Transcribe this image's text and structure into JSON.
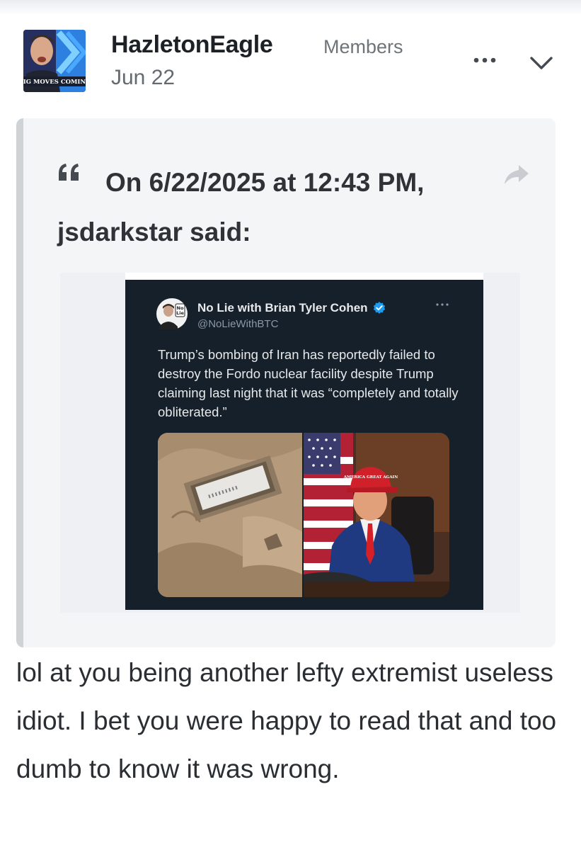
{
  "post": {
    "author": "HazletonEagle",
    "group": "Members",
    "date": "Jun 22",
    "avatar_caption": "BIG MOVES COMING",
    "quote": {
      "citation": "On 6/22/2025 at 12:43 PM, jsdarkstar said:",
      "embedded_tweet": {
        "display_name": "No Lie with Brian Tyler Cohen",
        "handle": "@NoLieWithBTC",
        "avatar_badge": "No Lie",
        "text": "Trump’s bombing of Iran has reportedly failed to destroy the Fordo nuclear facility despite Trump claiming last night that it was “completely and totally obliterated.”",
        "hat_text": "AMERICA GREAT AGAIN"
      }
    },
    "body": "lol at you being another lefty extremist useless idiot. I bet you were happy to read that and too dumb to know it was wrong."
  },
  "icons": {
    "more": "ellipsis-icon",
    "menu": "chevron-down-icon",
    "quote": "quote-mark-icon",
    "share": "share-arrow-icon",
    "verified": "verified-badge-icon"
  },
  "colors": {
    "tweet_background": "#15202b",
    "verified_blue": "#1d9bf0",
    "quote_background": "#f4f5f6",
    "quote_bar": "#d0d3d6"
  }
}
